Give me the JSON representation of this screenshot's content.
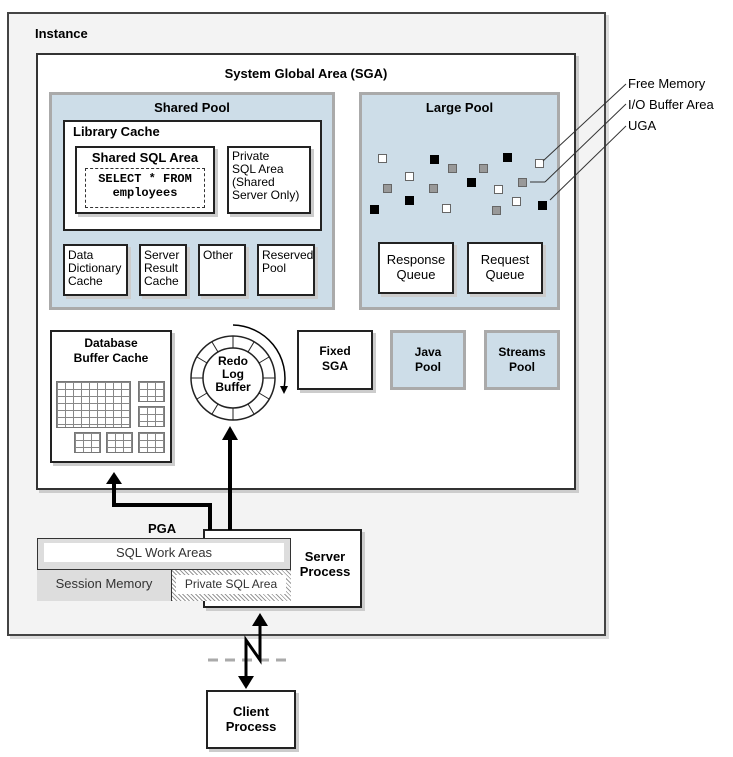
{
  "instance": {
    "label": "Instance"
  },
  "sga": {
    "label": "System Global Area (SGA)",
    "shared_pool": {
      "label": "Shared Pool",
      "library_cache": {
        "label": "Library Cache",
        "shared_sql_area": {
          "label": "Shared SQL Area",
          "sql_line1": "SELECT * FROM",
          "sql_line2": "employees"
        },
        "private_sql_area": {
          "line1": "Private",
          "line2": "SQL Area",
          "line3": "(Shared",
          "line4": "Server Only)"
        }
      },
      "sub_boxes": [
        {
          "line1": "Data",
          "line2": "Dictionary",
          "line3": "Cache"
        },
        {
          "line1": "Server",
          "line2": "Result",
          "line3": "Cache"
        },
        {
          "line1": "Other",
          "line2": "",
          "line3": ""
        },
        {
          "line1": "Reserved",
          "line2": "Pool",
          "line3": ""
        }
      ]
    },
    "large_pool": {
      "label": "Large Pool",
      "response_queue": {
        "line1": "Response",
        "line2": "Queue"
      },
      "request_queue": {
        "line1": "Request",
        "line2": "Queue"
      }
    },
    "database_buffer_cache": {
      "line1": "Database",
      "line2": "Buffer Cache"
    },
    "redo_log_buffer": {
      "line1": "Redo",
      "line2": "Log",
      "line3": "Buffer"
    },
    "fixed_sga": {
      "line1": "Fixed",
      "line2": "SGA"
    },
    "java_pool": {
      "line1": "Java",
      "line2": "Pool"
    },
    "streams_pool": {
      "line1": "Streams",
      "line2": "Pool"
    }
  },
  "legend": {
    "free_memory": "Free Memory",
    "io_buffer_area": "I/O Buffer Area",
    "uga": "UGA"
  },
  "pga": {
    "label": "PGA",
    "sql_work_areas": "SQL Work Areas",
    "session_memory": "Session Memory",
    "private_sql_area": "Private SQL Area"
  },
  "server_process": {
    "line1": "Server",
    "line2": "Process"
  },
  "client_process": {
    "line1": "Client",
    "line2": "Process"
  }
}
